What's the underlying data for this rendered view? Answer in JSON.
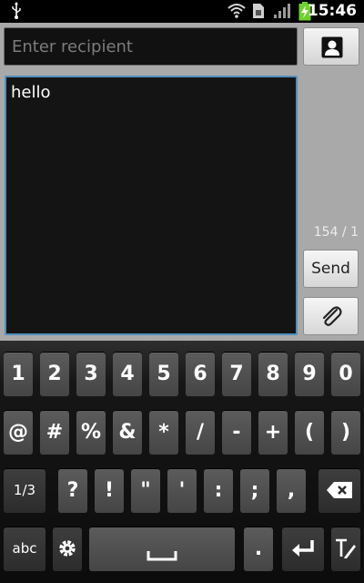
{
  "status_bar": {
    "time": "15:46",
    "icons": [
      "usb-icon",
      "wifi-icon",
      "sim-icon",
      "signal-icon",
      "battery-charging-icon"
    ]
  },
  "compose": {
    "recipient_placeholder": "Enter recipient",
    "message_text": "hello",
    "char_counter": "154 / 1",
    "send_label": "Send",
    "contact_icon": "contact-icon",
    "attach_icon": "paperclip-icon"
  },
  "keyboard": {
    "row1": [
      "1",
      "2",
      "3",
      "4",
      "5",
      "6",
      "7",
      "8",
      "9",
      "0"
    ],
    "row2": [
      "@",
      "#",
      "%",
      "&",
      "*",
      "/",
      "-",
      "+",
      "(",
      ")"
    ],
    "row3": {
      "page_label": "1/3",
      "keys": [
        "?",
        "!",
        "\"",
        "'",
        ":",
        ";",
        ","
      ],
      "backspace_icon": "backspace-icon"
    },
    "row4": {
      "abc_label": "abc",
      "settings_icon": "gear-icon",
      "space_icon": "space-icon",
      "period": ".",
      "enter_icon": "enter-icon",
      "handwriting_icon": "handwriting-icon"
    }
  },
  "colors": {
    "focus_border": "#4f8fbd",
    "compose_background": "#a9a9a9",
    "battery_green": "#6fd12a"
  }
}
